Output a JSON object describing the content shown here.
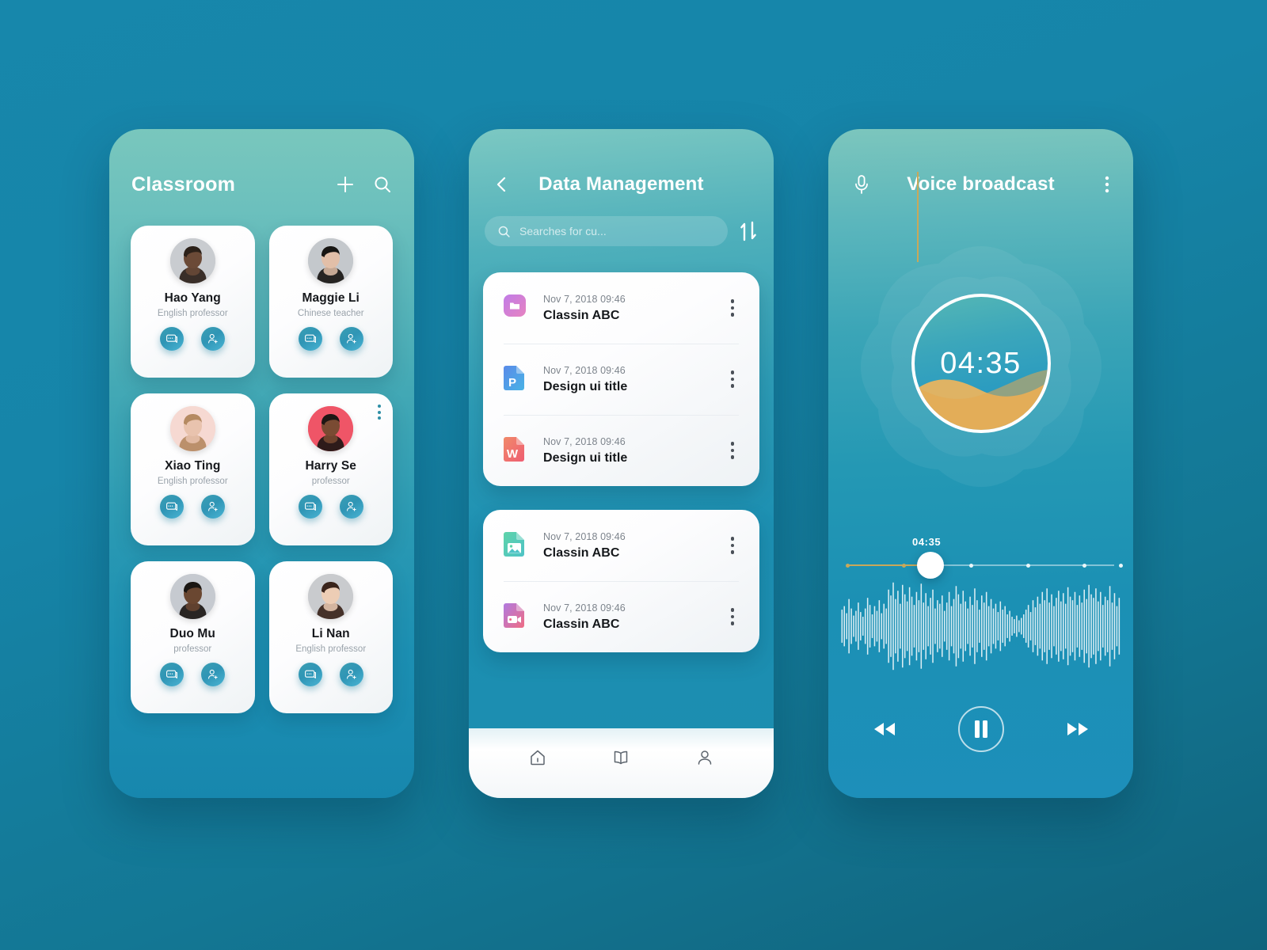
{
  "background": {
    "color_top": "#1787ab",
    "color_bottom": "#10637c"
  },
  "screen1": {
    "title": "Classroom",
    "actions": [
      {
        "name": "add-icon",
        "label": "+"
      },
      {
        "name": "search-icon",
        "label": "Search"
      }
    ],
    "teachers": [
      {
        "name": "Hao Yang",
        "role": "English professor",
        "avatar_bg": "#c9ccd0",
        "skin": "#6b4a37",
        "hair": "#2c2119",
        "menu": false
      },
      {
        "name": "Maggie Li",
        "role": "Chinese teacher",
        "avatar_bg": "#c4c8cc",
        "skin": "#e2bfa8",
        "hair": "#181613",
        "menu": false
      },
      {
        "name": "Xiao Ting",
        "role": "English professor",
        "avatar_bg": "#f6d9d2",
        "skin": "#e9c3ae",
        "hair": "#b58a62",
        "menu": false
      },
      {
        "name": "Harry Se",
        "role": "professor",
        "avatar_bg": "#ef5567",
        "skin": "#7a4b33",
        "hair": "#1d1714",
        "menu": true
      },
      {
        "name": "Duo Mu",
        "role": "professor",
        "avatar_bg": "#c6cad0",
        "skin": "#6a4731",
        "hair": "#1b1713",
        "menu": false
      },
      {
        "name": "Li Nan",
        "role": "English professor",
        "avatar_bg": "#c9cbce",
        "skin": "#edcdb5",
        "hair": "#3a241b",
        "menu": false
      }
    ],
    "card_actions": [
      {
        "name": "message-icon",
        "label": "Message"
      },
      {
        "name": "add-person-icon",
        "label": "Add contact"
      }
    ]
  },
  "screen2": {
    "title": "Data Management",
    "back_label": "Back",
    "search": {
      "placeholder": "Searches for cu...",
      "value": ""
    },
    "sort_label": "Sort",
    "groups": [
      {
        "files": [
          {
            "date": "Nov 7, 2018 09:46",
            "title": "Classin ABC",
            "type": "folder",
            "c1": "#c07ce8",
            "c2": "#e783c0"
          },
          {
            "date": "Nov 7, 2018 09:46",
            "title": "Design ui title",
            "type": "powerpoint",
            "c1": "#5a8ae8",
            "c2": "#49b3e6",
            "glyph": "P"
          },
          {
            "date": "Nov 7, 2018 09:46",
            "title": "Design ui title",
            "type": "word",
            "c1": "#f08a6a",
            "c2": "#ef5d72",
            "glyph": "W"
          }
        ]
      },
      {
        "files": [
          {
            "date": "Nov 7, 2018 09:46",
            "title": "Classin ABC",
            "type": "image",
            "c1": "#5fd3a9",
            "c2": "#4ec3c6"
          },
          {
            "date": "Nov 7, 2018 09:46",
            "title": "Classin ABC",
            "type": "video",
            "c1": "#b07ae0",
            "c2": "#ef6d84"
          }
        ]
      }
    ],
    "nav": [
      {
        "name": "home-icon",
        "label": "Home"
      },
      {
        "name": "book-icon",
        "label": "Library"
      },
      {
        "name": "person-icon",
        "label": "Profile"
      }
    ]
  },
  "screen3": {
    "title": "Voice broadcast",
    "mic_label": "Microphone",
    "menu_label": "More options",
    "timer": "04:35",
    "slider_time": "04:35",
    "progress_percent": 28,
    "accent_gold": "#c8a85a",
    "controls": [
      {
        "name": "rewind-button",
        "label": "Rewind"
      },
      {
        "name": "pause-button",
        "label": "Pause"
      },
      {
        "name": "forward-button",
        "label": "Forward"
      }
    ],
    "waveform": [
      28,
      34,
      22,
      46,
      30,
      18,
      26,
      40,
      24,
      16,
      30,
      48,
      36,
      20,
      34,
      26,
      44,
      22,
      38,
      30,
      62,
      52,
      74,
      46,
      60,
      38,
      70,
      54,
      42,
      66,
      50,
      36,
      58,
      44,
      72,
      40,
      56,
      34,
      48,
      62,
      30,
      44,
      38,
      52,
      26,
      40,
      58,
      34,
      46,
      68,
      54,
      38,
      60,
      42,
      30,
      50,
      36,
      64,
      44,
      28,
      52,
      40,
      58,
      34,
      46,
      30,
      38,
      24,
      42,
      28,
      34,
      20,
      26,
      16,
      12,
      18,
      10,
      14,
      20,
      28,
      36,
      24,
      44,
      32,
      50,
      38,
      58,
      44,
      64,
      40,
      54,
      34,
      48,
      60,
      42,
      56,
      38,
      66,
      50,
      44,
      58,
      36,
      52,
      40,
      62,
      46,
      70,
      54,
      48,
      64,
      42,
      58,
      36,
      50,
      44,
      68,
      40,
      56,
      34,
      48
    ]
  }
}
